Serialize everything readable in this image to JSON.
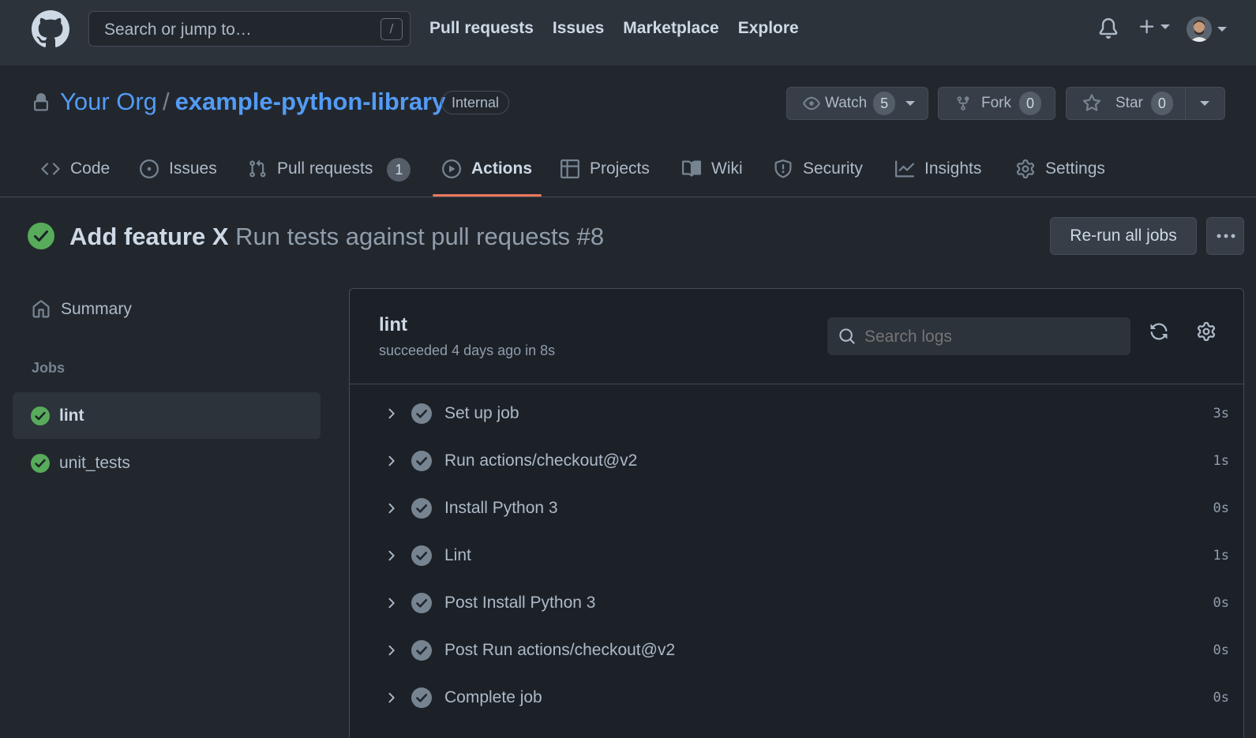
{
  "header": {
    "search_placeholder": "Search or jump to…",
    "search_shortcut": "/",
    "nav": [
      "Pull requests",
      "Issues",
      "Marketplace",
      "Explore"
    ]
  },
  "repo": {
    "owner": "Your Org",
    "separator": "/",
    "name": "example-python-library",
    "visibility": "Internal",
    "watch_label": "Watch",
    "watch_count": "5",
    "fork_label": "Fork",
    "fork_count": "0",
    "star_label": "Star",
    "star_count": "0"
  },
  "tabs": {
    "code": "Code",
    "issues": "Issues",
    "pull_requests": "Pull requests",
    "pull_requests_count": "1",
    "actions": "Actions",
    "projects": "Projects",
    "wiki": "Wiki",
    "security": "Security",
    "insights": "Insights",
    "settings": "Settings"
  },
  "run": {
    "title": "Add feature X",
    "workflow": "Run tests against pull requests #8",
    "rerun_label": "Re-run all jobs"
  },
  "sidebar": {
    "summary_label": "Summary",
    "jobs_heading": "Jobs",
    "jobs": [
      "lint",
      "unit_tests"
    ]
  },
  "job": {
    "name": "lint",
    "meta": "succeeded 4 days ago in 8s",
    "search_placeholder": "Search logs",
    "steps": [
      {
        "name": "Set up job",
        "duration": "3s"
      },
      {
        "name": "Run actions/checkout@v2",
        "duration": "1s"
      },
      {
        "name": "Install Python 3",
        "duration": "0s"
      },
      {
        "name": "Lint",
        "duration": "1s"
      },
      {
        "name": "Post Install Python 3",
        "duration": "0s"
      },
      {
        "name": "Post Run actions/checkout@v2",
        "duration": "0s"
      },
      {
        "name": "Complete job",
        "duration": "0s"
      }
    ]
  },
  "colors": {
    "background": "#22272e",
    "header": "#2d333b",
    "link": "#539bf5",
    "success": "#57ab5a",
    "active_tab_underline": "#ec775c"
  },
  "icons": {
    "logo": "github-logo-icon",
    "bell": "bell-icon",
    "plus": "plus-icon",
    "lock": "lock-icon",
    "eye": "eye-icon",
    "fork": "repo-forked-icon",
    "star": "star-icon",
    "success": "check-circle-fill-icon",
    "step_ok": "check-circle-icon",
    "chevron": "chevron-right-icon"
  }
}
